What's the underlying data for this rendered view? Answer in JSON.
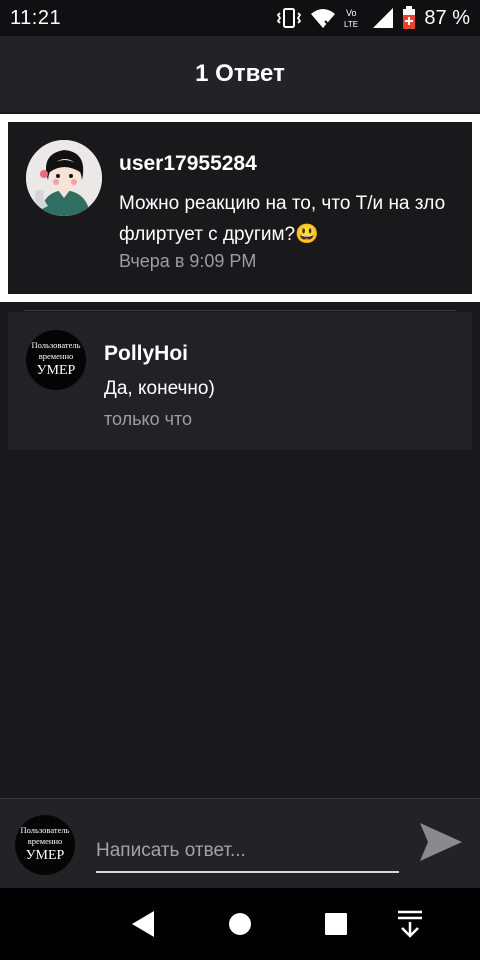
{
  "status_bar": {
    "time": "11:21",
    "battery_percent": "87 %",
    "icons": [
      "vibrate-icon",
      "wifi-icon",
      "volte-icon",
      "signal-icon",
      "battery-icon"
    ],
    "volte_label_top": "Vo",
    "volte_label_bottom": "LTE"
  },
  "header": {
    "title": "1 Ответ"
  },
  "original_comment": {
    "username": "user17955284",
    "text": "Можно реакцию на то, что Т/и на зло флиртует с другим?😃",
    "timestamp": "Вчера в 9:09 PM"
  },
  "reply": {
    "username": "PollyHoi",
    "text": "Да, конечно)",
    "timestamp": "только что",
    "avatar_lines": [
      "Пользователь",
      "временно",
      "УМЕР"
    ]
  },
  "composer": {
    "placeholder": "Написать ответ...",
    "avatar_lines": [
      "Пользователь",
      "временно",
      "УМЕР"
    ]
  },
  "navbar": {
    "items": [
      "back-icon",
      "home-icon",
      "recents-icon",
      "hide-nav-icon"
    ]
  },
  "colors": {
    "background": "#19181b",
    "header_bg": "#232226",
    "reply_bg": "#222125",
    "muted_text": "#9d9ca2"
  }
}
